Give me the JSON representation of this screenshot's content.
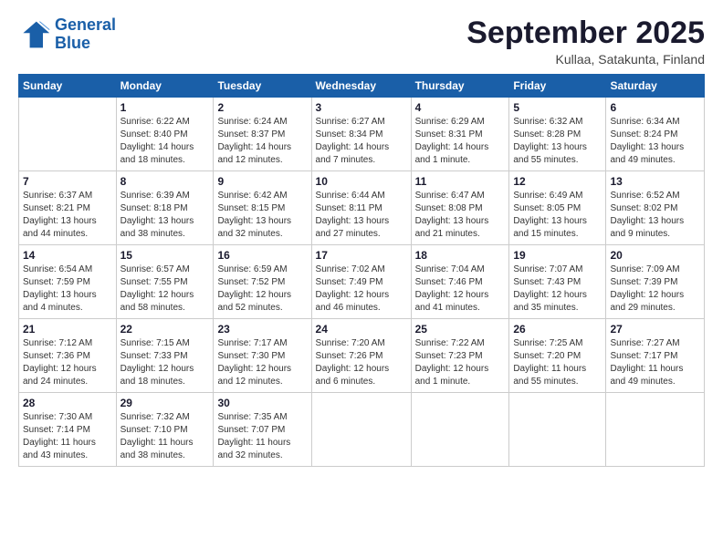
{
  "logo": {
    "line1": "General",
    "line2": "Blue"
  },
  "title": "September 2025",
  "location": "Kullaa, Satakunta, Finland",
  "days_of_week": [
    "Sunday",
    "Monday",
    "Tuesday",
    "Wednesday",
    "Thursday",
    "Friday",
    "Saturday"
  ],
  "weeks": [
    [
      {
        "day": "",
        "info": ""
      },
      {
        "day": "1",
        "info": "Sunrise: 6:22 AM\nSunset: 8:40 PM\nDaylight: 14 hours\nand 18 minutes."
      },
      {
        "day": "2",
        "info": "Sunrise: 6:24 AM\nSunset: 8:37 PM\nDaylight: 14 hours\nand 12 minutes."
      },
      {
        "day": "3",
        "info": "Sunrise: 6:27 AM\nSunset: 8:34 PM\nDaylight: 14 hours\nand 7 minutes."
      },
      {
        "day": "4",
        "info": "Sunrise: 6:29 AM\nSunset: 8:31 PM\nDaylight: 14 hours\nand 1 minute."
      },
      {
        "day": "5",
        "info": "Sunrise: 6:32 AM\nSunset: 8:28 PM\nDaylight: 13 hours\nand 55 minutes."
      },
      {
        "day": "6",
        "info": "Sunrise: 6:34 AM\nSunset: 8:24 PM\nDaylight: 13 hours\nand 49 minutes."
      }
    ],
    [
      {
        "day": "7",
        "info": "Sunrise: 6:37 AM\nSunset: 8:21 PM\nDaylight: 13 hours\nand 44 minutes."
      },
      {
        "day": "8",
        "info": "Sunrise: 6:39 AM\nSunset: 8:18 PM\nDaylight: 13 hours\nand 38 minutes."
      },
      {
        "day": "9",
        "info": "Sunrise: 6:42 AM\nSunset: 8:15 PM\nDaylight: 13 hours\nand 32 minutes."
      },
      {
        "day": "10",
        "info": "Sunrise: 6:44 AM\nSunset: 8:11 PM\nDaylight: 13 hours\nand 27 minutes."
      },
      {
        "day": "11",
        "info": "Sunrise: 6:47 AM\nSunset: 8:08 PM\nDaylight: 13 hours\nand 21 minutes."
      },
      {
        "day": "12",
        "info": "Sunrise: 6:49 AM\nSunset: 8:05 PM\nDaylight: 13 hours\nand 15 minutes."
      },
      {
        "day": "13",
        "info": "Sunrise: 6:52 AM\nSunset: 8:02 PM\nDaylight: 13 hours\nand 9 minutes."
      }
    ],
    [
      {
        "day": "14",
        "info": "Sunrise: 6:54 AM\nSunset: 7:59 PM\nDaylight: 13 hours\nand 4 minutes."
      },
      {
        "day": "15",
        "info": "Sunrise: 6:57 AM\nSunset: 7:55 PM\nDaylight: 12 hours\nand 58 minutes."
      },
      {
        "day": "16",
        "info": "Sunrise: 6:59 AM\nSunset: 7:52 PM\nDaylight: 12 hours\nand 52 minutes."
      },
      {
        "day": "17",
        "info": "Sunrise: 7:02 AM\nSunset: 7:49 PM\nDaylight: 12 hours\nand 46 minutes."
      },
      {
        "day": "18",
        "info": "Sunrise: 7:04 AM\nSunset: 7:46 PM\nDaylight: 12 hours\nand 41 minutes."
      },
      {
        "day": "19",
        "info": "Sunrise: 7:07 AM\nSunset: 7:43 PM\nDaylight: 12 hours\nand 35 minutes."
      },
      {
        "day": "20",
        "info": "Sunrise: 7:09 AM\nSunset: 7:39 PM\nDaylight: 12 hours\nand 29 minutes."
      }
    ],
    [
      {
        "day": "21",
        "info": "Sunrise: 7:12 AM\nSunset: 7:36 PM\nDaylight: 12 hours\nand 24 minutes."
      },
      {
        "day": "22",
        "info": "Sunrise: 7:15 AM\nSunset: 7:33 PM\nDaylight: 12 hours\nand 18 minutes."
      },
      {
        "day": "23",
        "info": "Sunrise: 7:17 AM\nSunset: 7:30 PM\nDaylight: 12 hours\nand 12 minutes."
      },
      {
        "day": "24",
        "info": "Sunrise: 7:20 AM\nSunset: 7:26 PM\nDaylight: 12 hours\nand 6 minutes."
      },
      {
        "day": "25",
        "info": "Sunrise: 7:22 AM\nSunset: 7:23 PM\nDaylight: 12 hours\nand 1 minute."
      },
      {
        "day": "26",
        "info": "Sunrise: 7:25 AM\nSunset: 7:20 PM\nDaylight: 11 hours\nand 55 minutes."
      },
      {
        "day": "27",
        "info": "Sunrise: 7:27 AM\nSunset: 7:17 PM\nDaylight: 11 hours\nand 49 minutes."
      }
    ],
    [
      {
        "day": "28",
        "info": "Sunrise: 7:30 AM\nSunset: 7:14 PM\nDaylight: 11 hours\nand 43 minutes."
      },
      {
        "day": "29",
        "info": "Sunrise: 7:32 AM\nSunset: 7:10 PM\nDaylight: 11 hours\nand 38 minutes."
      },
      {
        "day": "30",
        "info": "Sunrise: 7:35 AM\nSunset: 7:07 PM\nDaylight: 11 hours\nand 32 minutes."
      },
      {
        "day": "",
        "info": ""
      },
      {
        "day": "",
        "info": ""
      },
      {
        "day": "",
        "info": ""
      },
      {
        "day": "",
        "info": ""
      }
    ]
  ]
}
